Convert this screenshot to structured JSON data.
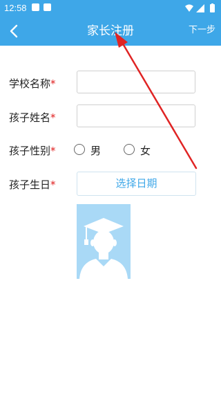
{
  "status_bar": {
    "time": "12:58"
  },
  "nav": {
    "title": "家长注册",
    "next_label": "下一步"
  },
  "form": {
    "school_name": {
      "label": "学校名称",
      "required": "*",
      "value": ""
    },
    "child_name": {
      "label": "孩子姓名",
      "required": "*",
      "value": ""
    },
    "child_gender": {
      "label": "孩子性别",
      "required": "*",
      "options": [
        "男",
        "女"
      ]
    },
    "child_birthday": {
      "label": "孩子生日",
      "required": "*",
      "button_label": "选择日期"
    }
  },
  "colors": {
    "primary": "#3ea7e8",
    "required": "#e02020",
    "avatar_bg": "#a9d9f6",
    "annotation_arrow": "#e02424"
  },
  "icons": {
    "back": "chevron-left-icon",
    "avatar": "graduate-avatar-icon",
    "wifi": "wifi-icon",
    "signal": "signal-icon",
    "battery": "battery-icon"
  }
}
